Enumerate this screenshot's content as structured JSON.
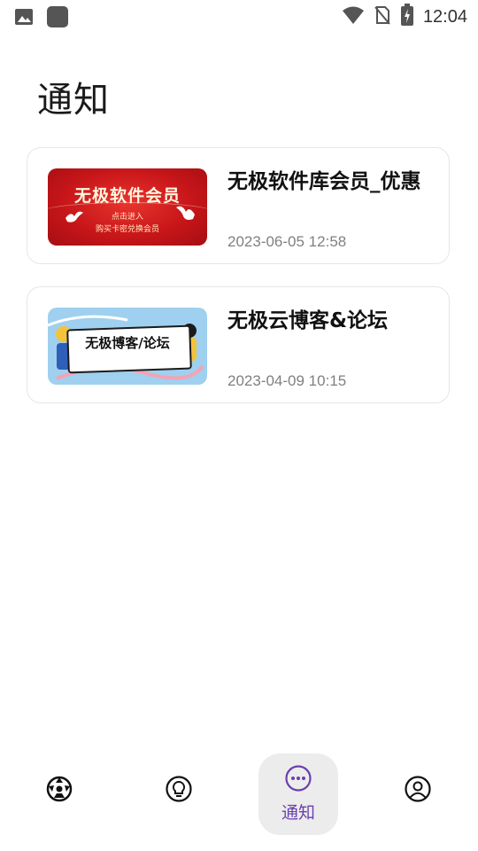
{
  "status_bar": {
    "time": "12:04",
    "icons": [
      "image-icon",
      "app-icon",
      "wifi-icon",
      "no-sim-icon",
      "battery-charging-icon"
    ]
  },
  "page": {
    "title": "通知"
  },
  "notifications": [
    {
      "title": "无极软件库会员_优惠",
      "date": "2023-06-05 12:58",
      "thumbnail": {
        "main_text": "无极软件会员",
        "line1": "点击进入",
        "line2": "购买卡密兑换会员"
      }
    },
    {
      "title": "无极云博客&论坛",
      "date": "2023-04-09 10:15",
      "thumbnail": {
        "main_text": "无极博客/论坛"
      }
    }
  ],
  "bottom_nav": {
    "items": [
      {
        "icon": "ball-icon",
        "label": ""
      },
      {
        "icon": "lightbulb-icon",
        "label": ""
      },
      {
        "icon": "more-dots-icon",
        "label": "通知",
        "active": true
      },
      {
        "icon": "user-icon",
        "label": ""
      }
    ]
  },
  "colors": {
    "accent": "#6a3fb0",
    "active_bg": "#ececec",
    "card_border": "#e6e6e6",
    "date_text": "#808080"
  }
}
